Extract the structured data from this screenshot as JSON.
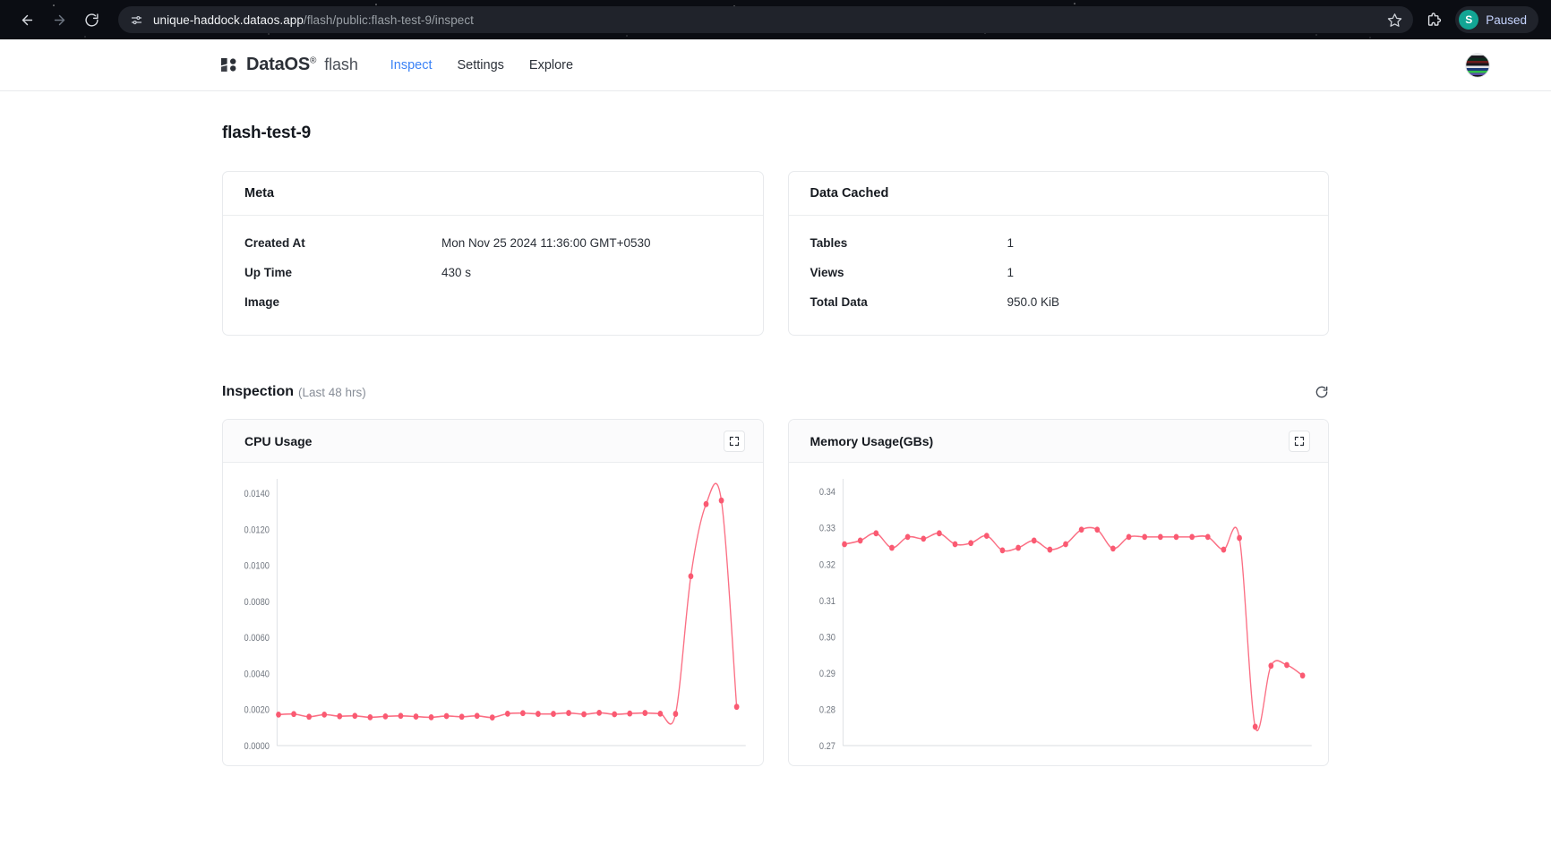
{
  "browser": {
    "back_icon": "back-arrow-icon",
    "forward_icon": "forward-arrow-icon",
    "reload_icon": "reload-icon",
    "site_info_icon": "site-settings-icon",
    "url_host": "unique-haddock.dataos.app",
    "url_path": "/flash/public:flash-test-9/inspect",
    "bookmark_icon": "star-icon",
    "extensions_icon": "puzzle-piece-icon",
    "profile_initial": "S",
    "profile_status": "Paused"
  },
  "header": {
    "brand_name": "DataOS",
    "brand_reg": "®",
    "brand_sub": "flash",
    "nav": [
      {
        "label": "Inspect",
        "active": true
      },
      {
        "label": "Settings",
        "active": false
      },
      {
        "label": "Explore",
        "active": false
      }
    ],
    "avatar_name": "user-avatar"
  },
  "page": {
    "title": "flash-test-9"
  },
  "meta_card": {
    "title": "Meta",
    "rows": [
      {
        "key": "Created At",
        "value": "Mon Nov 25 2024 11:36:00 GMT+0530"
      },
      {
        "key": "Up Time",
        "value": "430 s"
      },
      {
        "key": "Image",
        "value": ""
      }
    ]
  },
  "data_cached_card": {
    "title": "Data Cached",
    "rows": [
      {
        "key": "Tables",
        "value": "1"
      },
      {
        "key": "Views",
        "value": "1"
      },
      {
        "key": "Total Data",
        "value": "950.0 KiB"
      }
    ]
  },
  "inspection": {
    "title": "Inspection",
    "subtitle": "(Last 48 hrs)",
    "refresh_icon": "refresh-icon"
  },
  "charts": {
    "cpu": {
      "title": "CPU Usage",
      "expand_icon": "expand-icon"
    },
    "memory": {
      "title": "Memory Usage(GBs)",
      "expand_icon": "expand-icon"
    }
  },
  "colors": {
    "accent": "#3b82f6",
    "series": "#fb6f84",
    "series_marker": "#fa5a72",
    "axis": "#d9dce0",
    "card_border": "#e8eaed",
    "text": "#15191f",
    "muted": "#878d97"
  },
  "chart_data": [
    {
      "id": "cpu",
      "type": "line",
      "title": "CPU Usage",
      "xlabel": "",
      "ylabel": "",
      "ylim": [
        0.0,
        0.0148
      ],
      "yticks": [
        0.0,
        0.002,
        0.004,
        0.006,
        0.008,
        0.01,
        0.012,
        0.014
      ],
      "ytick_labels": [
        "0.0000",
        "0.0020",
        "0.0040",
        "0.0060",
        "0.0080",
        "0.0100",
        "0.0120",
        "0.0140"
      ],
      "grid": false,
      "legend": "none",
      "markers": true,
      "values": [
        0.00172,
        0.00175,
        0.0016,
        0.00172,
        0.00163,
        0.00165,
        0.00157,
        0.00162,
        0.00165,
        0.00161,
        0.00157,
        0.00164,
        0.0016,
        0.00165,
        0.00156,
        0.00177,
        0.0018,
        0.00176,
        0.00176,
        0.00181,
        0.00174,
        0.00182,
        0.00174,
        0.00178,
        0.00181,
        0.00177,
        0.00176,
        0.0094,
        0.0134,
        0.0136,
        0.00215
      ]
    },
    {
      "id": "memory",
      "type": "line",
      "title": "Memory Usage(GBs)",
      "xlabel": "",
      "ylabel": "",
      "ylim": [
        0.27,
        0.3435
      ],
      "yticks": [
        0.27,
        0.28,
        0.29,
        0.3,
        0.31,
        0.32,
        0.33,
        0.34
      ],
      "ytick_labels": [
        "0.27",
        "0.28",
        "0.29",
        "0.30",
        "0.31",
        "0.32",
        "0.33",
        "0.34"
      ],
      "grid": false,
      "legend": "none",
      "markers": true,
      "values": [
        0.3255,
        0.3265,
        0.3285,
        0.3245,
        0.3275,
        0.327,
        0.3285,
        0.3255,
        0.3258,
        0.3278,
        0.3238,
        0.3245,
        0.3265,
        0.324,
        0.3255,
        0.3295,
        0.3295,
        0.3243,
        0.3275,
        0.3275,
        0.3275,
        0.3275,
        0.3275,
        0.3275,
        0.324,
        0.3272,
        0.2752,
        0.292,
        0.2922,
        0.2893
      ]
    }
  ]
}
